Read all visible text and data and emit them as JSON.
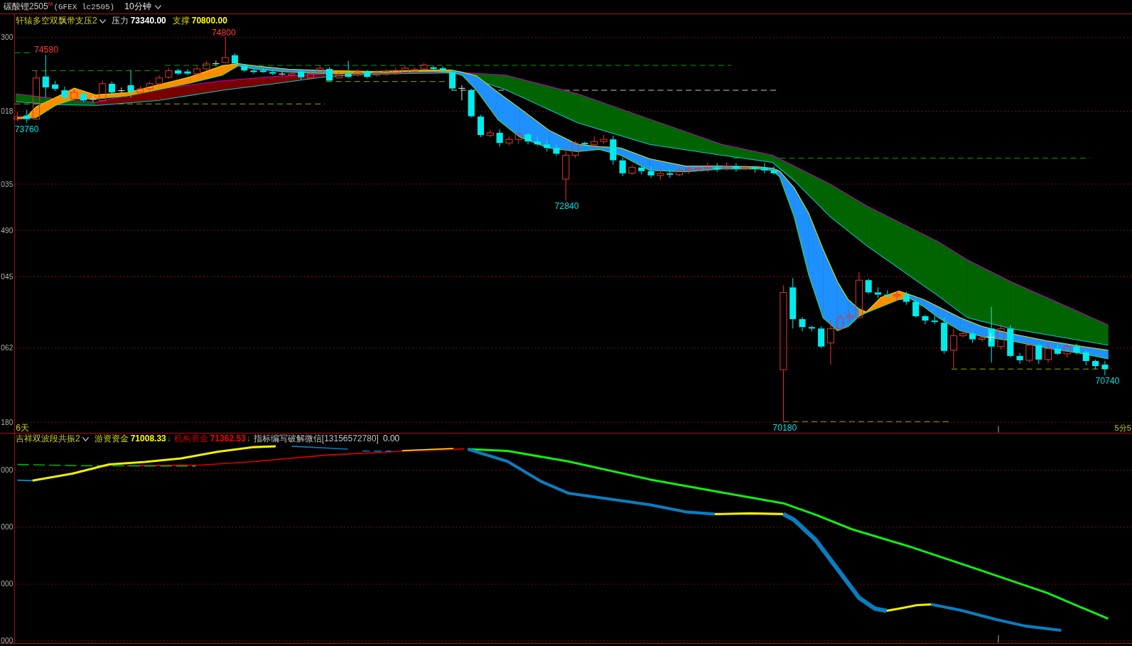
{
  "title_bar": {
    "symbol": "碳酸锂2505$^{M}$",
    "code": "(GFEX lc2505)",
    "period": "10分钟"
  },
  "main_panel": {
    "indicator": {
      "name": "轩辕多空双飘带支压2",
      "readings": [
        {
          "label": "压力",
          "value": "73340.00",
          "color": "#ffffff"
        },
        {
          "label": "支撑",
          "value": "70800.00",
          "color": "#ffff00"
        }
      ]
    },
    "axis_labels": [
      "300",
      "018",
      "035",
      "490",
      "045",
      "062",
      "180"
    ],
    "price_labels": [
      {
        "text": "74800",
        "kind": "high"
      },
      {
        "text": "74580",
        "kind": "high"
      },
      {
        "text": "73760",
        "kind": "low"
      },
      {
        "text": "72840",
        "kind": "low"
      },
      {
        "text": "70180",
        "kind": "low"
      },
      {
        "text": "70740",
        "kind": "low"
      }
    ],
    "span_label": "6天",
    "period_label": "5分5"
  },
  "sub_panel": {
    "indicator": {
      "name": "吉祥双波段共振2",
      "readings": [
        {
          "label": "游资资金",
          "value": "71008.33",
          "color": "#ffff00",
          "arrow": "↓"
        },
        {
          "label": "机构资金",
          "value": "71362.53",
          "color": "#ff0000",
          "arrow": "↓"
        }
      ],
      "note": "指标编写破解微信[13156572780]",
      "note_value": "0.00"
    },
    "axis_labels": [
      "000",
      "000",
      "000",
      "000"
    ]
  }
}
